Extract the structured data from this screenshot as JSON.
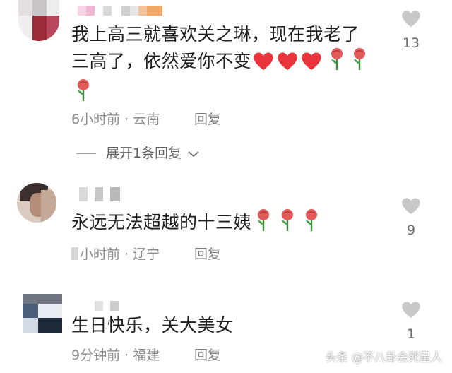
{
  "comments": [
    {
      "text_line1": "我上高三就喜欢关之琳，现在我老了",
      "text_line2": "三高了，依然爱你不变",
      "time": "6小时前",
      "location": "云南",
      "reply": "回复",
      "expand": "展开1条回复",
      "likes": "13"
    },
    {
      "text_line1": "永远无法超越的十三姨",
      "time": "小时前",
      "location": "辽宁",
      "reply": "回复",
      "likes": "9"
    },
    {
      "text_line1": "生日快乐，关大美女",
      "time": "9分钟前",
      "location": "福建",
      "reply": "回复",
      "likes": "1"
    }
  ],
  "separator": "·",
  "watermark": "头条 @不八卦会死星人",
  "colors": {
    "heart_red": "#e8343a",
    "rose_red": "#e25a5a",
    "like_gray": "#c8c8c8"
  },
  "icons": [
    "heart-emoji",
    "rose-emoji",
    "like-heart-icon",
    "chevron-down-icon"
  ]
}
